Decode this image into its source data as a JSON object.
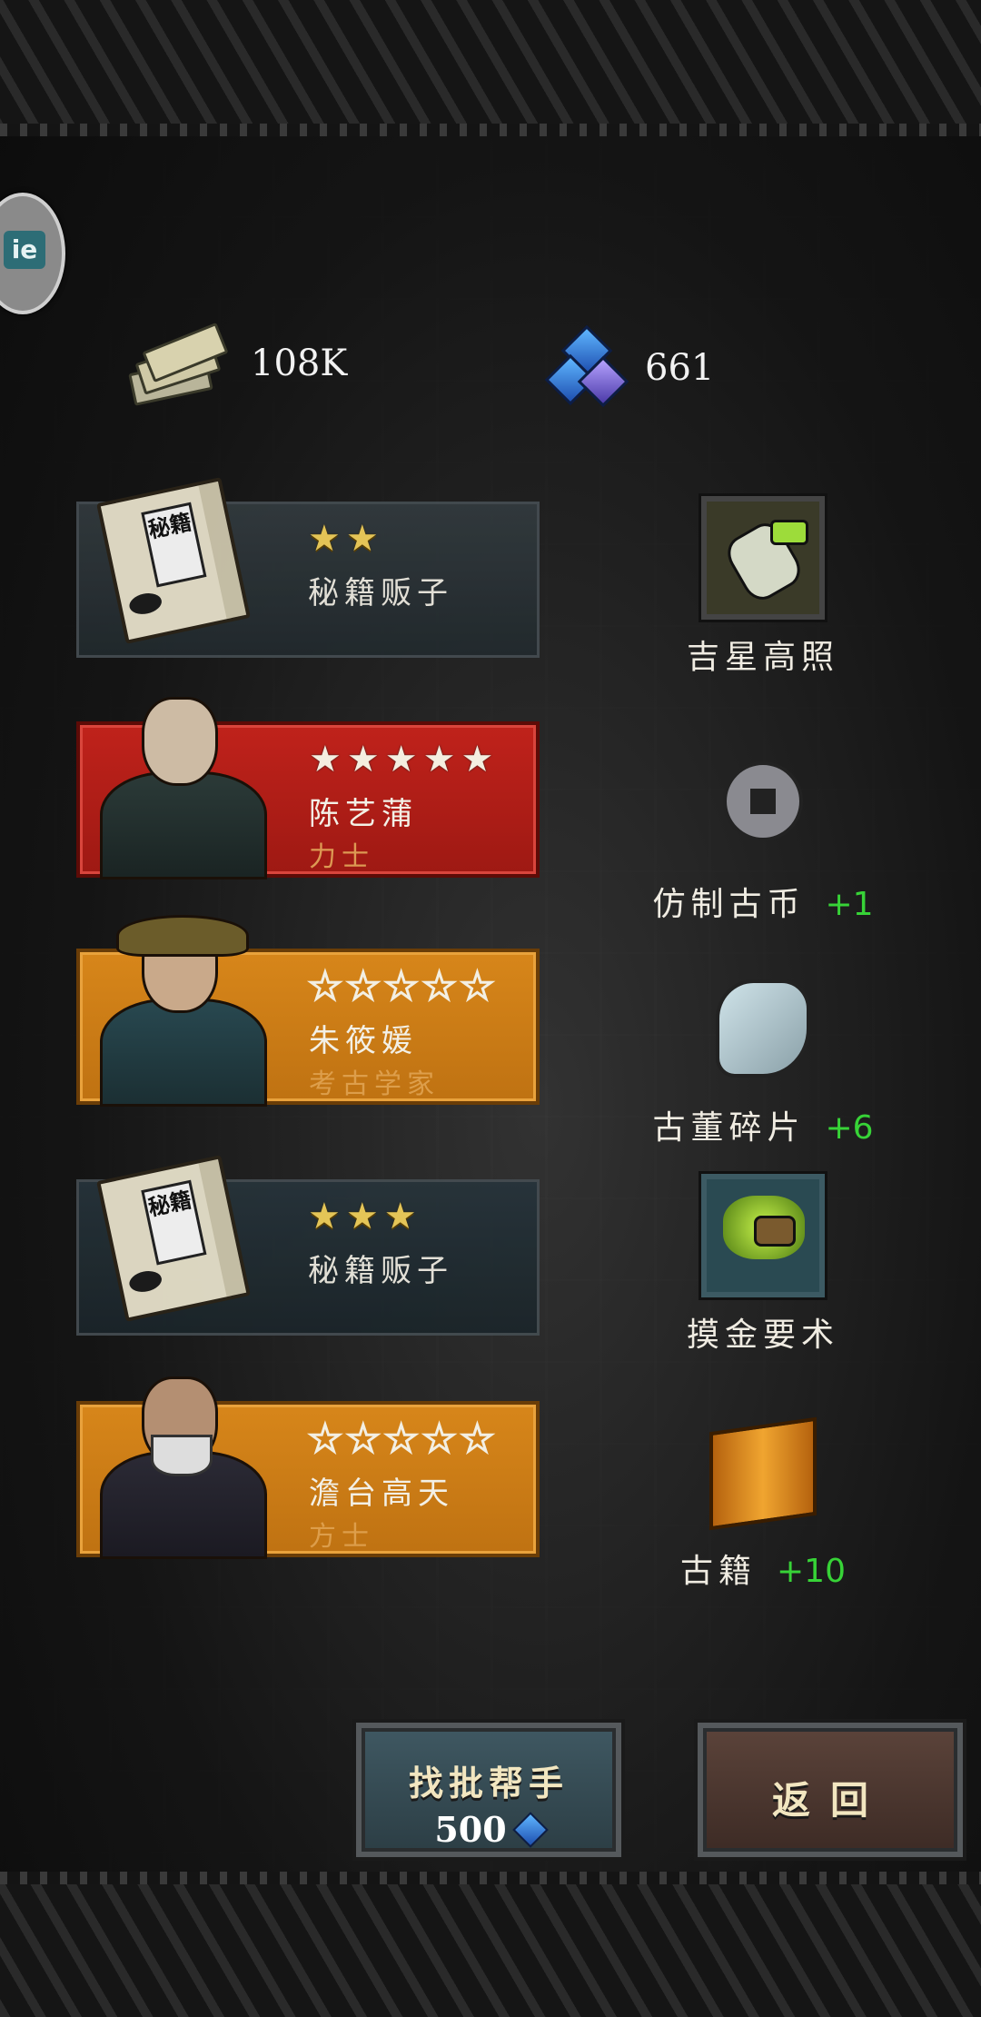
{
  "currency": {
    "cash_icon": "cash-stack-icon",
    "cash": "108K",
    "gem_icon": "blue-gems-icon",
    "gems": "661"
  },
  "cards": [
    {
      "type": "item",
      "book_label": "秘籍",
      "stars_filled": 2,
      "stars_total": 2,
      "name": "秘籍贩子",
      "class": ""
    },
    {
      "type": "hero",
      "stars_filled": 5,
      "stars_total": 5,
      "name": "陈艺蒲",
      "class": "力士"
    },
    {
      "type": "hero",
      "stars_filled": 0,
      "stars_total": 5,
      "name": "朱筱媛",
      "class": "考古学家"
    },
    {
      "type": "item",
      "book_label": "秘籍",
      "stars_filled": 3,
      "stars_total": 3,
      "name": "秘籍贩子",
      "class": ""
    },
    {
      "type": "hero",
      "stars_filled": 0,
      "stars_total": 5,
      "name": "澹台高天",
      "class": "方士"
    }
  ],
  "rewards": [
    {
      "icon": "lucky-star-skill-icon",
      "label": "吉星高照",
      "amount": ""
    },
    {
      "icon": "ancient-coin-icon",
      "label": "仿制古币",
      "amount": "+1"
    },
    {
      "icon": "antique-shard-icon",
      "label": "古董碎片",
      "amount": "+6"
    },
    {
      "icon": "gold-touch-skill-icon",
      "label": "摸金要术",
      "amount": ""
    },
    {
      "icon": "ancient-scroll-icon",
      "label": "古籍",
      "amount": "+10"
    }
  ],
  "buttons": {
    "helper_label": "找批帮手",
    "helper_cost": "500",
    "back_label": "返回"
  },
  "side_badge_text": "ie",
  "colors": {
    "plus": "#37d337",
    "red_card": "#c0221b",
    "gold_card": "#d7861a"
  }
}
